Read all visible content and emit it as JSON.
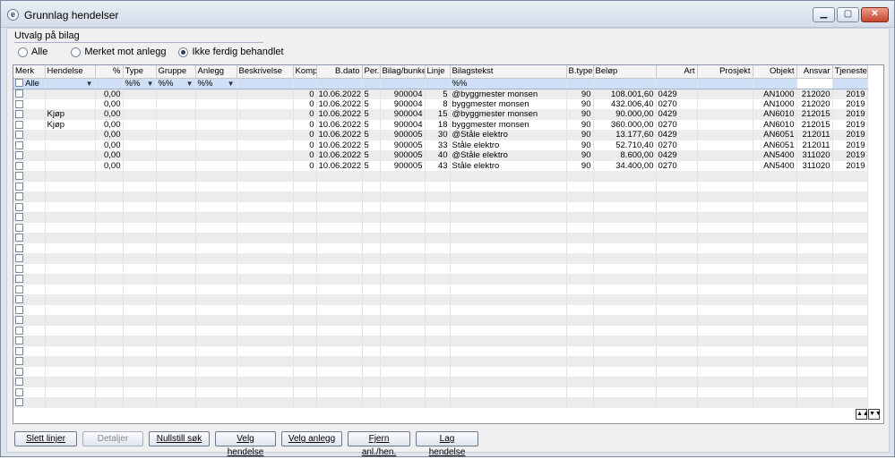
{
  "window": {
    "title": "Grunnlag hendelser"
  },
  "filter": {
    "section_label": "Utvalg på bilag",
    "options": [
      "Alle",
      "Merket mot anlegg",
      "Ikke ferdig behandlet"
    ],
    "selected": "Ikke ferdig behandlet"
  },
  "grid": {
    "columns": [
      "Merk",
      "Hendelse",
      "%",
      "Type",
      "Gruppe",
      "Anlegg",
      "Beskrivelse",
      "Komp",
      "B.dato",
      "Per.",
      "Bilag/bunke",
      "Linje",
      "Bilagstekst",
      "B.type",
      "Beløp",
      "Art",
      "Prosjekt",
      "Objekt",
      "Ansvar",
      "Tjeneste"
    ],
    "filter_row": {
      "merk": "Alle",
      "type": "%%",
      "gruppe": "%%",
      "anlegg": "%%",
      "bilagstekst": "%%"
    },
    "rows": [
      {
        "hendelse": "",
        "pct": "0,00",
        "komp": "0",
        "bdato": "10.06.2022",
        "per": "5",
        "bilag": "900004",
        "linje": "5",
        "tekst": "@byggmester monsen",
        "btype": "90",
        "belop": "108.001,60",
        "art": "0429",
        "prosjekt": "",
        "objekt": "AN1000",
        "ansvar": "212020",
        "tjeneste": "2019"
      },
      {
        "hendelse": "",
        "pct": "0,00",
        "komp": "0",
        "bdato": "10.06.2022",
        "per": "5",
        "bilag": "900004",
        "linje": "8",
        "tekst": "byggmester monsen",
        "btype": "90",
        "belop": "432.006,40",
        "art": "0270",
        "prosjekt": "",
        "objekt": "AN1000",
        "ansvar": "212020",
        "tjeneste": "2019"
      },
      {
        "hendelse": "Kjøp",
        "pct": "0,00",
        "komp": "0",
        "bdato": "10.06.2022",
        "per": "5",
        "bilag": "900004",
        "linje": "15",
        "tekst": "@byggmester monsen",
        "btype": "90",
        "belop": "90.000,00",
        "art": "0429",
        "prosjekt": "",
        "objekt": "AN6010",
        "ansvar": "212015",
        "tjeneste": "2019"
      },
      {
        "hendelse": "Kjøp",
        "pct": "0,00",
        "komp": "0",
        "bdato": "10.06.2022",
        "per": "5",
        "bilag": "900004",
        "linje": "18",
        "tekst": "byggmester monsen",
        "btype": "90",
        "belop": "360.000,00",
        "art": "0270",
        "prosjekt": "",
        "objekt": "AN6010",
        "ansvar": "212015",
        "tjeneste": "2019"
      },
      {
        "hendelse": "",
        "pct": "0,00",
        "komp": "0",
        "bdato": "10.06.2022",
        "per": "5",
        "bilag": "900005",
        "linje": "30",
        "tekst": "@Ståle elektro",
        "btype": "90",
        "belop": "13.177,60",
        "art": "0429",
        "prosjekt": "",
        "objekt": "AN6051",
        "ansvar": "212011",
        "tjeneste": "2019"
      },
      {
        "hendelse": "",
        "pct": "0,00",
        "komp": "0",
        "bdato": "10.06.2022",
        "per": "5",
        "bilag": "900005",
        "linje": "33",
        "tekst": "Ståle elektro",
        "btype": "90",
        "belop": "52.710,40",
        "art": "0270",
        "prosjekt": "",
        "objekt": "AN6051",
        "ansvar": "212011",
        "tjeneste": "2019"
      },
      {
        "hendelse": "",
        "pct": "0,00",
        "komp": "0",
        "bdato": "10.06.2022",
        "per": "5",
        "bilag": "900005",
        "linje": "40",
        "tekst": "@Ståle elektro",
        "btype": "90",
        "belop": "8.600,00",
        "art": "0429",
        "prosjekt": "",
        "objekt": "AN5400",
        "ansvar": "311020",
        "tjeneste": "2019"
      },
      {
        "hendelse": "",
        "pct": "0,00",
        "komp": "0",
        "bdato": "10.06.2022",
        "per": "5",
        "bilag": "900005",
        "linje": "43",
        "tekst": "Ståle elektro",
        "btype": "90",
        "belop": "34.400,00",
        "art": "0270",
        "prosjekt": "",
        "objekt": "AN5400",
        "ansvar": "311020",
        "tjeneste": "2019"
      }
    ]
  },
  "buttons": {
    "slett_linjer": "Slett linjer",
    "detaljer": "Detaljer",
    "nullstill_sok": "Nullstill søk",
    "velg_hendelse": "Velg hendelse",
    "velg_anlegg": "Velg anlegg",
    "fjern_anl_hen": "Fjern anl./hen.",
    "lag_hendelse": "Lag hendelse"
  }
}
